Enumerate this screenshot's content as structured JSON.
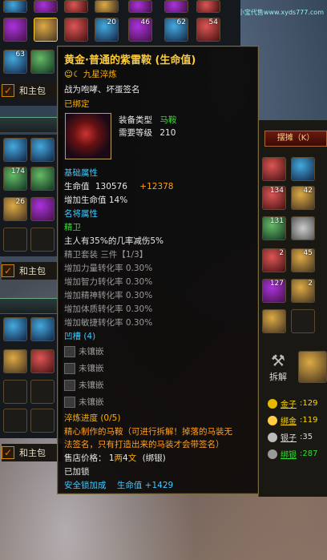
{
  "watermark": "小宝代售www.xyds777.com",
  "left_panel": {
    "slots_row1_counts": [
      "63"
    ],
    "checkbox1_label": "和主包",
    "slots_row2_counts": [
      "174",
      "26"
    ],
    "checkbox2_label": "和主包",
    "checkbox3_label": "和主包",
    "top_counts": [
      "20",
      "46",
      "62",
      "54"
    ]
  },
  "right_panel": {
    "stall_button": "摆摊（K）",
    "dismantle_label": "拆解",
    "counts": [
      "134",
      "42",
      "131",
      "45",
      "2",
      "2",
      "127"
    ],
    "money": [
      {
        "label": "金子",
        "value": ":129",
        "color": "#ffd700"
      },
      {
        "label": "绑金",
        "value": ":119",
        "color": "#ffd700"
      },
      {
        "label": "银子",
        "value": ":35",
        "color": "#dddddd"
      },
      {
        "label": "绑银",
        "value": ":287",
        "color": "#33dd33"
      }
    ]
  },
  "tooltip": {
    "title": "黄金·普通的紫雷鞍 (生命值)",
    "refine_label": "九星淬炼",
    "binding_source": "战为咆哮、坏蛋签名",
    "bound": "已绑定",
    "equip_type_label": "装备类型",
    "equip_type_value": "马鞍",
    "level_label": "需要等级",
    "level_value": "210",
    "basic_attr_header": "基础属性",
    "hp_label": "生命值",
    "hp_value": "130576",
    "hp_bonus": "+12378",
    "hp_pct": "增加生命值 14%",
    "famous_header": "名将属性",
    "set_name": "精卫",
    "set_desc": "主人有35%的几率减伤5%",
    "set_line": "精卫套装 三件【1/3】",
    "set_attrs": [
      "增加力量转化率 0.30%",
      "增加智力转化率 0.30%",
      "增加精神转化率 0.30%",
      "增加体质转化率 0.30%",
      "增加敏捷转化率 0.30%"
    ],
    "socket_header": "凹槽 (4)",
    "sockets": [
      "未镶嵌",
      "未镶嵌",
      "未镶嵌",
      "未镶嵌"
    ],
    "refine_progress": "淬炼进度 (0/5)",
    "note": "精心制作的马鞍（可进行拆解！掉落的马装无法签名，只有打造出来的马装才会带签名）",
    "note_line1": "精心制作的马鞍（可进行拆解！掉落的马装无",
    "note_line2": "法签名，只有打造出来的马装才会带签名）",
    "price_label": "售店价格：",
    "price_gold": "1",
    "price_gold_unit": "两",
    "price_silver": "4",
    "price_silver_unit": "文",
    "price_bound": "(绑银)",
    "locked": "已加锁",
    "safety_bonus": "安全锁加成",
    "safety_hp": "生命值 +1429"
  }
}
